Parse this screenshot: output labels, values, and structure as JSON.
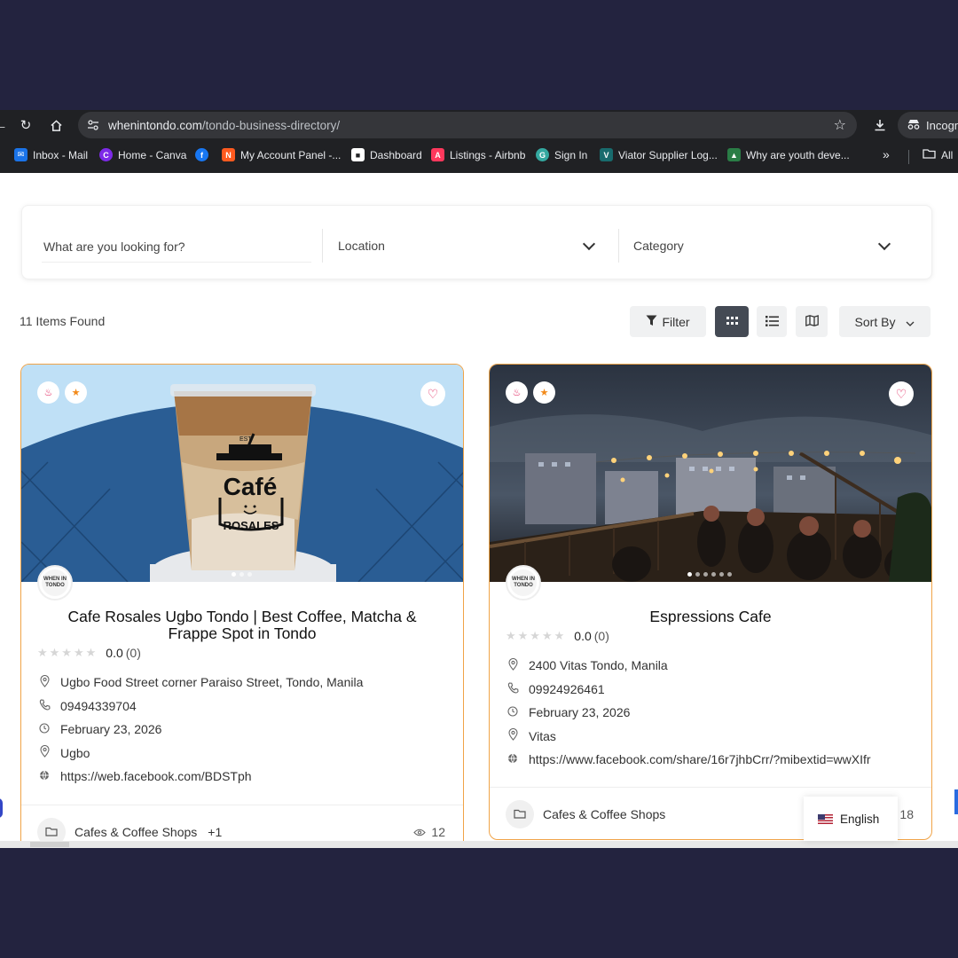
{
  "browser": {
    "url_domain": "whenintondo.com",
    "url_path": "/tondo-business-directory/",
    "incognito_label": "Incogn",
    "bookmarks": [
      {
        "label": "Inbox - Mail",
        "color": "#1a73e8",
        "glyph": "✉"
      },
      {
        "label": "Home - Canva",
        "color": "#7d2ae8",
        "glyph": "C"
      },
      {
        "label": "",
        "color": "#1877f2",
        "glyph": "f"
      },
      {
        "label": "My Account Panel -...",
        "color": "#ff5a1f",
        "glyph": "N"
      },
      {
        "label": "Dashboard",
        "color": "#ffffff",
        "glyph": "■"
      },
      {
        "label": "Listings - Airbnb",
        "color": "#ff385c",
        "glyph": "A"
      },
      {
        "label": "Sign In",
        "color": "#34a8a0",
        "glyph": "G"
      },
      {
        "label": "Viator Supplier Log...",
        "color": "#186b6d",
        "glyph": "V"
      },
      {
        "label": "Why are youth deve...",
        "color": "#2a7d46",
        "glyph": "▲"
      }
    ],
    "bookmarks_more": "»",
    "all_bookmarks": "All"
  },
  "search": {
    "placeholder": "What are you looking for?",
    "location": "Location",
    "category": "Category"
  },
  "toolbar": {
    "items_found": "11 Items Found",
    "filter": "Filter",
    "sort": "Sort By"
  },
  "listings": [
    {
      "title": "Cafe Rosales Ugbo Tondo | Best Coffee, Matcha & Frappe Spot in Tondo",
      "rating": "0.0",
      "rating_count": "(0)",
      "address": "Ugbo Food Street corner Paraiso Street, Tondo, Manila",
      "phone": "09494339704",
      "date": "February 23, 2026",
      "area": "Ugbo",
      "website": "https://web.facebook.com/BDSTph",
      "category": "Cafes & Coffee Shops",
      "extra_categories": "+1",
      "views": "12",
      "image_text": "Café",
      "image_subtext": "ROSALES",
      "image_topline": "EST",
      "logo_text": "WHEN IN TONDO"
    },
    {
      "title": "Espressions Cafe",
      "rating": "0.0",
      "rating_count": "(0)",
      "address": "2400 Vitas Tondo, Manila",
      "phone": "09924926461",
      "date": "February 23, 2026",
      "area": "Vitas",
      "website": "https://www.facebook.com/share/16r7jhbCrr/?mibextid=wwXIfr",
      "category": "Cafes & Coffee Shops",
      "views": "18",
      "logo_text": "WHEN IN TONDO"
    }
  ],
  "language": {
    "label": "English"
  },
  "colors": {
    "page_bg": "#23233f",
    "accent_border": "#f0a347",
    "active_view": "#444a54",
    "heart": "#e0245e"
  }
}
